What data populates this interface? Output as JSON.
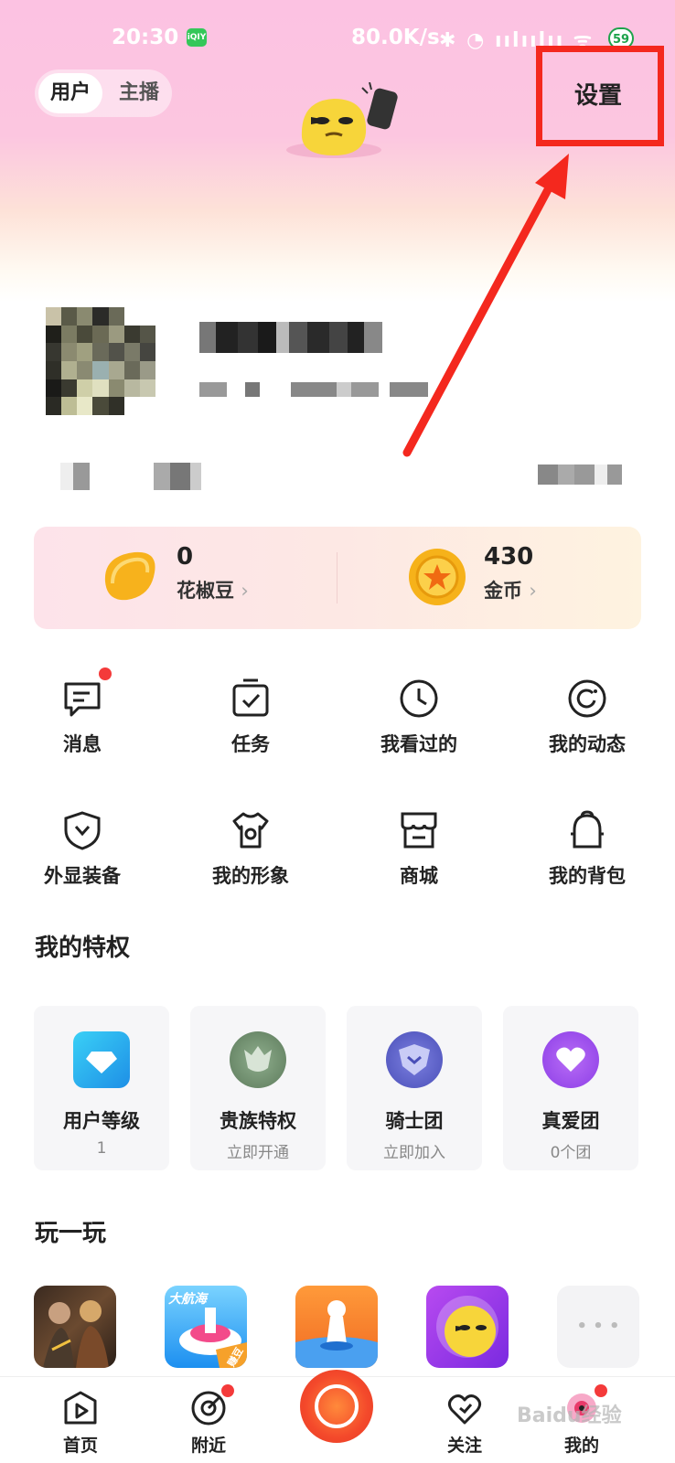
{
  "status_bar": {
    "time": "20:30",
    "app_icon_text": "iQIY",
    "network_speed": "80.0K/s",
    "icons": "✱ ◔ ıılıılıı ᯤ",
    "battery": "59"
  },
  "header": {
    "role_user": "用户",
    "role_host": "主播",
    "settings_label": "设置"
  },
  "wallet": {
    "beans": {
      "value": "0",
      "label": "花椒豆",
      "chevron": "›"
    },
    "coins": {
      "value": "430",
      "label": "金币",
      "chevron": "›"
    }
  },
  "quick_actions": [
    {
      "label": "消息",
      "icon": "message-icon",
      "badge": true
    },
    {
      "label": "任务",
      "icon": "task-icon",
      "badge": false
    },
    {
      "label": "我看过的",
      "icon": "clock-icon",
      "badge": false
    },
    {
      "label": "我的动态",
      "icon": "moments-icon",
      "badge": false
    },
    {
      "label": "外显装备",
      "icon": "shield-icon",
      "badge": false
    },
    {
      "label": "我的形象",
      "icon": "shirt-icon",
      "badge": false
    },
    {
      "label": "商城",
      "icon": "shop-icon",
      "badge": false
    },
    {
      "label": "我的背包",
      "icon": "backpack-icon",
      "badge": false
    }
  ],
  "privileges": {
    "title": "我的特权",
    "items": [
      {
        "name": "用户等级",
        "sub": "1",
        "icon": "diamond-icon",
        "color": "#2fb4f0"
      },
      {
        "name": "贵族特权",
        "sub": "立即开通",
        "icon": "noble-icon",
        "color": "#6f8f6e"
      },
      {
        "name": "骑士团",
        "sub": "立即加入",
        "icon": "knight-icon",
        "color": "#5a5fc8"
      },
      {
        "name": "真爱团",
        "sub": "0个团",
        "icon": "heart-icon",
        "color": "#a052f0"
      }
    ]
  },
  "games": {
    "title": "玩一玩",
    "tiles": [
      {
        "icon": "game-warriors-icon"
      },
      {
        "icon": "game-voyage-icon",
        "label": "大航海",
        "tag": "赚豆"
      },
      {
        "icon": "game-chess-icon"
      },
      {
        "icon": "game-mascot-icon"
      },
      {
        "icon": "more-icon",
        "label": "• • •"
      }
    ]
  },
  "bottom_nav": [
    {
      "label": "首页",
      "icon": "home-play-icon"
    },
    {
      "label": "附近",
      "icon": "nearby-icon",
      "badge": true
    },
    {
      "label": "",
      "icon": "live-camera-icon"
    },
    {
      "label": "关注",
      "icon": "heart-follow-icon"
    },
    {
      "label": "我的",
      "icon": "profile-icon",
      "badge": true
    }
  ],
  "watermark": "Baidu经验",
  "colors": {
    "accent_red": "#f4281e",
    "badge_red": "#f43a3a",
    "header_pink": "#fcc2e2"
  }
}
